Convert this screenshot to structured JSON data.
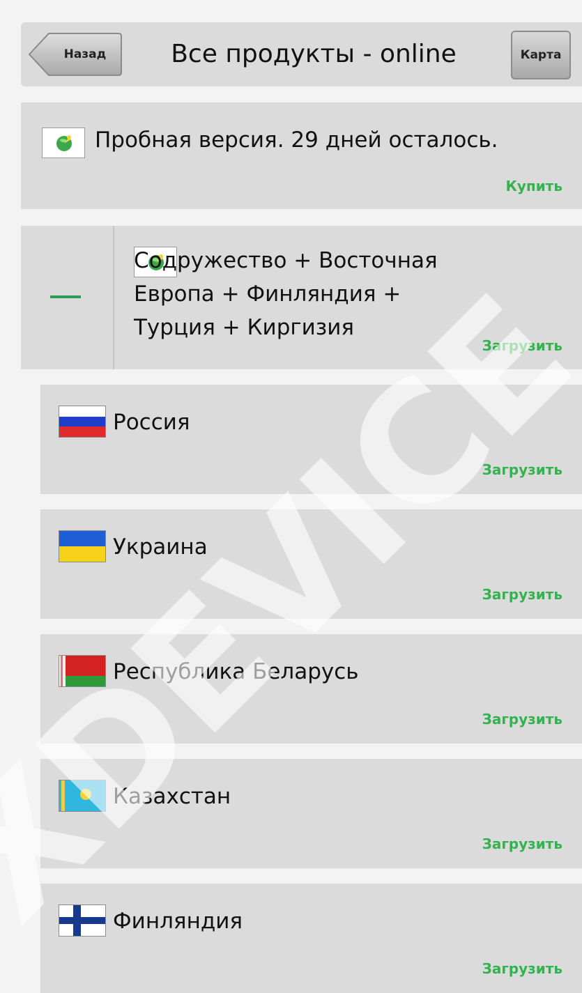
{
  "header": {
    "back_label": "Назад",
    "title": "Все продукты - online",
    "map_label": "Карта"
  },
  "trial": {
    "icon": "globe-icon",
    "text": "Пробная версия. 29 дней осталось.",
    "buy_label": "Купить"
  },
  "group": {
    "icon": "globe-icon",
    "title": "Содружество + Восточная\n        Европа + Финляндия +\nТурция + Киргизия",
    "download_label": "Загрузить",
    "collapse_icon": "minus-icon"
  },
  "countries": [
    {
      "name": "Россия",
      "flag": "russia-flag-icon",
      "download_label": "Загрузить"
    },
    {
      "name": "Украина",
      "flag": "ukraine-flag-icon",
      "download_label": "Загрузить"
    },
    {
      "name": "Республика Беларусь",
      "flag": "belarus-flag-icon",
      "download_label": "Загрузить"
    },
    {
      "name": "Казахстан",
      "flag": "kazakhstan-flag-icon",
      "download_label": "Загрузить"
    },
    {
      "name": "Финляндия",
      "flag": "finland-flag-icon",
      "download_label": "Загрузить"
    }
  ],
  "colors": {
    "accent_green": "#34b24f",
    "panel_bg": "#dcdbdc",
    "page_bg": "#f3f3f3"
  },
  "watermark": "XDEVICE"
}
